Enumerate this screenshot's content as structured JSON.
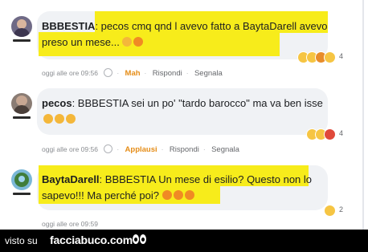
{
  "comments": [
    {
      "author": "BBBESTIA",
      "line1": ": pecos cmq qnd l avevo fatto a BaytaDarell avevo",
      "line2": "preso un mese...",
      "time": "oggi alle ore 09:56",
      "reaction_label": "Mah",
      "reply_label": "Rispondi",
      "report_label": "Segnala",
      "reaction_count": "4"
    },
    {
      "author": "pecos",
      "line1": ": BBBESTIA sei un po' \"tardo barocco\" ma va ben isse",
      "line2": "",
      "time": "oggi alle ore 09:56",
      "reaction_label": "Applausi",
      "reply_label": "Rispondi",
      "report_label": "Segnala",
      "reaction_count": "4"
    },
    {
      "author": "BaytaDarell",
      "line1": ": BBBESTIA Un mese di esilio? Questo non lo",
      "line2": "sapevo!!! Ma perché poi?",
      "time": "oggi alle ore 09:59",
      "reaction_count": "2"
    }
  ],
  "footer": {
    "visto": "visto su",
    "brand": "facciabuco.com"
  },
  "colors": {
    "highlight": "#f7ec1b",
    "bubble": "#f0f2f5",
    "reaction_accent": "#e58d18"
  }
}
